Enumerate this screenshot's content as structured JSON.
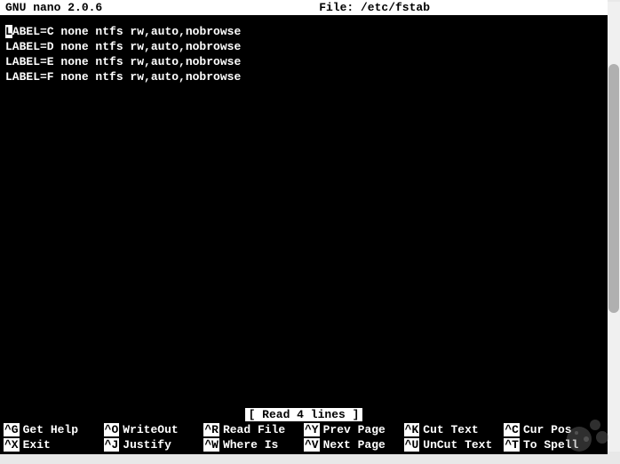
{
  "titlebar": {
    "app": "GNU nano 2.0.6",
    "file_label": "File: /etc/fstab"
  },
  "content": {
    "lines": [
      {
        "prefix": "L",
        "rest": "ABEL=C none ntfs rw,auto,nobrowse",
        "cursor": true
      },
      {
        "prefix": "",
        "rest": "LABEL=D none ntfs rw,auto,nobrowse",
        "cursor": false
      },
      {
        "prefix": "",
        "rest": "LABEL=E none ntfs rw,auto,nobrowse",
        "cursor": false
      },
      {
        "prefix": "",
        "rest": "LABEL=F none ntfs rw,auto,nobrowse",
        "cursor": false
      }
    ]
  },
  "status": {
    "message": "[ Read 4 lines ]"
  },
  "shortcuts": [
    {
      "key": "^G",
      "label": "Get Help"
    },
    {
      "key": "^O",
      "label": "WriteOut"
    },
    {
      "key": "^R",
      "label": "Read File"
    },
    {
      "key": "^Y",
      "label": "Prev Page"
    },
    {
      "key": "^K",
      "label": "Cut Text"
    },
    {
      "key": "^C",
      "label": "Cur Pos"
    },
    {
      "key": "^X",
      "label": "Exit"
    },
    {
      "key": "^J",
      "label": "Justify"
    },
    {
      "key": "^W",
      "label": "Where Is"
    },
    {
      "key": "^V",
      "label": "Next Page"
    },
    {
      "key": "^U",
      "label": "UnCut Text"
    },
    {
      "key": "^T",
      "label": "To Spell"
    }
  ]
}
